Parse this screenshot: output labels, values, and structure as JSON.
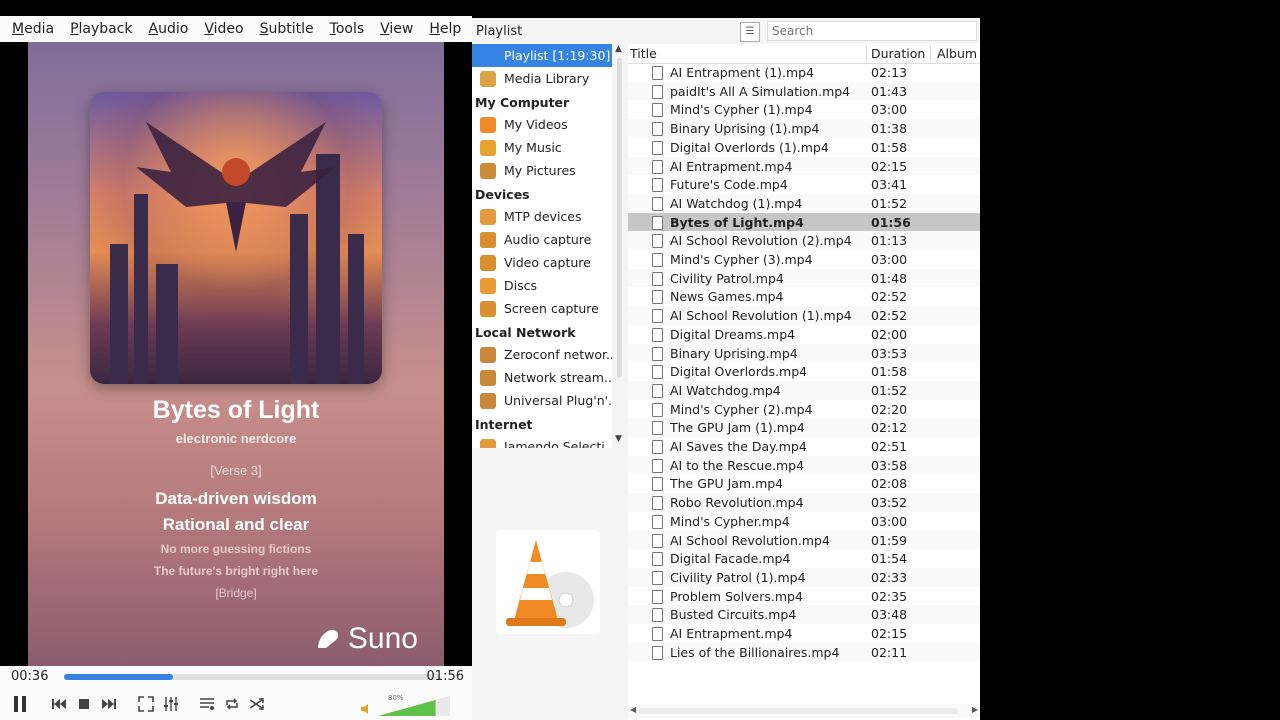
{
  "menubar": [
    "Media",
    "Playback",
    "Audio",
    "Video",
    "Subtitle",
    "Tools",
    "View",
    "Help"
  ],
  "video": {
    "title": "Bytes of Light",
    "genre": "electronic nerdcore",
    "lyrics": [
      "[Verse 3]",
      "Data-driven wisdom",
      "Rational and clear",
      "No more guessing fictions",
      "The future's bright right here",
      "[Bridge]"
    ],
    "brand": "Suno"
  },
  "player": {
    "elapsed": "00:36",
    "total": "01:56",
    "progress": 0.29,
    "volume_label": "80%",
    "volume": 0.8
  },
  "playlist_panel": {
    "header": "Playlist",
    "search_placeholder": "Search",
    "sidebar": [
      {
        "type": "item",
        "label": "Playlist [1:19:30]",
        "selected": true,
        "icon": "playlist-icon",
        "color": "#3584e4"
      },
      {
        "type": "item",
        "label": "Media Library",
        "icon": "library-icon",
        "color": "#d9a441"
      },
      {
        "type": "head",
        "label": "My Computer"
      },
      {
        "type": "item",
        "label": "My Videos",
        "icon": "video-folder-icon",
        "color": "#f08a24"
      },
      {
        "type": "item",
        "label": "My Music",
        "icon": "music-note-icon",
        "color": "#e7a32c"
      },
      {
        "type": "item",
        "label": "My Pictures",
        "icon": "pictures-icon",
        "color": "#c98d3a"
      },
      {
        "type": "head",
        "label": "Devices"
      },
      {
        "type": "item",
        "label": "MTP devices",
        "icon": "phone-icon",
        "color": "#e39a3d"
      },
      {
        "type": "item",
        "label": "Audio capture",
        "icon": "audio-capture-icon",
        "color": "#d98f2e"
      },
      {
        "type": "item",
        "label": "Video capture",
        "icon": "video-capture-icon",
        "color": "#d98f2e"
      },
      {
        "type": "item",
        "label": "Discs",
        "icon": "disc-icon",
        "color": "#e89a35"
      },
      {
        "type": "item",
        "label": "Screen capture",
        "icon": "screen-capture-icon",
        "color": "#d98f2e"
      },
      {
        "type": "head",
        "label": "Local Network"
      },
      {
        "type": "item",
        "label": "Zeroconf networ...",
        "icon": "network-icon",
        "color": "#c9883a"
      },
      {
        "type": "item",
        "label": "Network stream...",
        "icon": "network-icon",
        "color": "#c9883a"
      },
      {
        "type": "item",
        "label": "Universal Plug'n'...",
        "icon": "network-icon",
        "color": "#c9883a"
      },
      {
        "type": "head",
        "label": "Internet"
      },
      {
        "type": "item",
        "label": "Jamendo Selecti...",
        "icon": "internet-icon",
        "color": "#e39a3d"
      }
    ],
    "columns": {
      "title": "Title",
      "duration": "Duration",
      "album": "Album"
    },
    "rows": [
      {
        "title": "AI Entrapment (1).mp4",
        "duration": "02:13"
      },
      {
        "title": "paidIt's All A Simulation.mp4",
        "duration": "01:43"
      },
      {
        "title": "Mind's Cypher (1).mp4",
        "duration": "03:00"
      },
      {
        "title": "Binary Uprising (1).mp4",
        "duration": "01:38"
      },
      {
        "title": "Digital Overlords (1).mp4",
        "duration": "01:58"
      },
      {
        "title": "AI Entrapment.mp4",
        "duration": "02:15"
      },
      {
        "title": "Future's Code.mp4",
        "duration": "03:41"
      },
      {
        "title": "AI Watchdog (1).mp4",
        "duration": "01:52"
      },
      {
        "title": "Bytes of Light.mp4",
        "duration": "01:56",
        "selected": true
      },
      {
        "title": "AI School Revolution (2).mp4",
        "duration": "01:13"
      },
      {
        "title": "Mind's Cypher (3).mp4",
        "duration": "03:00"
      },
      {
        "title": "Civility Patrol.mp4",
        "duration": "01:48"
      },
      {
        "title": "News Games.mp4",
        "duration": "02:52"
      },
      {
        "title": "AI School Revolution (1).mp4",
        "duration": "02:52"
      },
      {
        "title": "Digital Dreams.mp4",
        "duration": "02:00"
      },
      {
        "title": "Binary Uprising.mp4",
        "duration": "03:53"
      },
      {
        "title": "Digital Overlords.mp4",
        "duration": "01:58"
      },
      {
        "title": "AI Watchdog.mp4",
        "duration": "01:52"
      },
      {
        "title": "Mind's Cypher (2).mp4",
        "duration": "02:20"
      },
      {
        "title": "The GPU Jam (1).mp4",
        "duration": "02:12"
      },
      {
        "title": "AI Saves the Day.mp4",
        "duration": "02:51"
      },
      {
        "title": "AI to the Rescue.mp4",
        "duration": "03:58"
      },
      {
        "title": "The GPU Jam.mp4",
        "duration": "02:08"
      },
      {
        "title": "Robo Revolution.mp4",
        "duration": "03:52"
      },
      {
        "title": "Mind's Cypher.mp4",
        "duration": "03:00"
      },
      {
        "title": "AI School Revolution.mp4",
        "duration": "01:59"
      },
      {
        "title": "Digital Facade.mp4",
        "duration": "01:54"
      },
      {
        "title": "Civility Patrol (1).mp4",
        "duration": "02:33"
      },
      {
        "title": "Problem Solvers.mp4",
        "duration": "02:35"
      },
      {
        "title": "Busted Circuits.mp4",
        "duration": "03:48"
      },
      {
        "title": "AI Entrapment.mp4",
        "duration": "02:15"
      },
      {
        "title": "Lies of the Billionaires.mp4",
        "duration": "02:11"
      }
    ]
  }
}
